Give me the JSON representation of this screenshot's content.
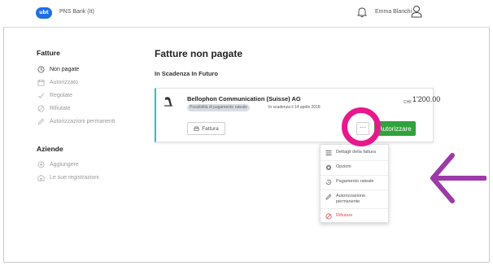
{
  "header": {
    "logo_text": "ubt",
    "bank_name": "PNS Bank (It)",
    "user_name": "Emma Blanchi"
  },
  "sidebar": {
    "section1_title": "Fatture",
    "section1_items": [
      {
        "label": "Non pagate",
        "icon": "clock-icon",
        "active": true
      },
      {
        "label": "Autorizzato",
        "icon": "calendar-icon",
        "active": false
      },
      {
        "label": "Regolate",
        "icon": "check-icon",
        "active": false
      },
      {
        "label": "Rifiutate",
        "icon": "ban-icon",
        "active": false
      },
      {
        "label": "Autorizzazioni permanenti",
        "icon": "pen-icon",
        "active": false
      }
    ],
    "section2_title": "Aziende",
    "section2_items": [
      {
        "label": "Aggiungere",
        "icon": "plus-circle-icon",
        "active": false
      },
      {
        "label": "Le sue registrazioni",
        "icon": "building-icon",
        "active": false
      }
    ]
  },
  "main": {
    "title": "Fatture non pagate",
    "section_label": "In Scadenza In Futuro"
  },
  "invoice": {
    "company": "Bellophon Communication (Suisse) AG",
    "currency": "CHF",
    "amount": "1'200.00",
    "badge": "Possibilità di pagamento rateale",
    "due": "In scadenza il 14 aprile 2018",
    "fattura_label": "Fattura",
    "more_label": "···",
    "authorize_label": "Autorizzare"
  },
  "dropdown": {
    "items": [
      {
        "label": "Dettagli della fattura",
        "icon": "list-icon"
      },
      {
        "label": "Opzioni",
        "icon": "gear-icon"
      },
      {
        "label": "Pagamento rateale",
        "icon": "history-icon"
      },
      {
        "label": "Autorizzazione permanente",
        "icon": "pen-icon"
      },
      {
        "label": "Rifiutare",
        "icon": "ban-icon"
      }
    ]
  },
  "colors": {
    "accent_blue": "#1f6fe0",
    "card_border": "#27c2d0",
    "authorize_green": "#2fa23c",
    "highlight_circle": "#e8188c",
    "arrow": "#9b3aa8",
    "danger": "#d9534f"
  }
}
